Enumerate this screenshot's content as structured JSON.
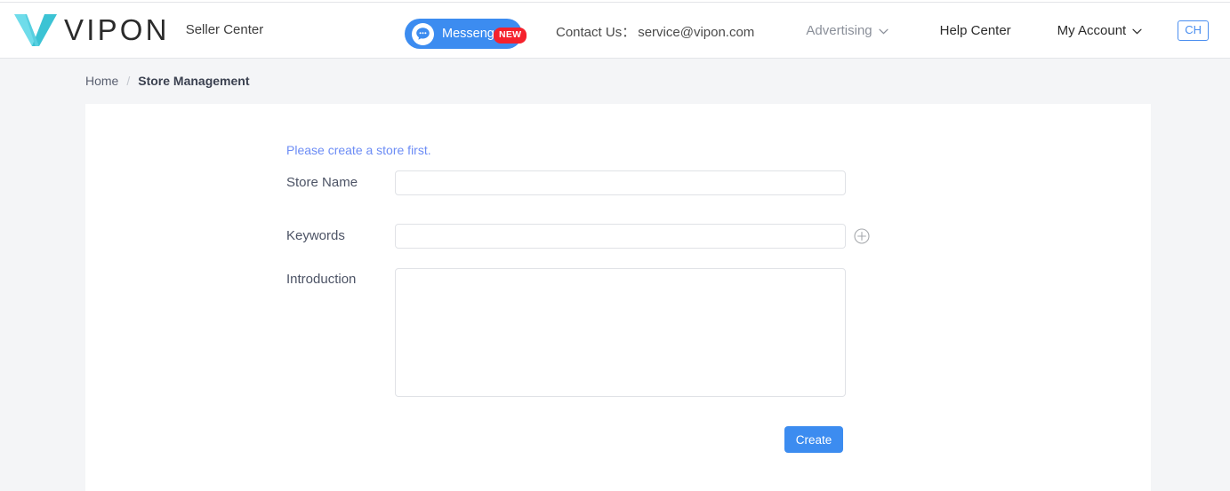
{
  "theme": {
    "page_bg": "#f4f5f7",
    "card_bg": "#ffffff",
    "accent_blue": "#3c8cf0",
    "badge_red": "#f5222d",
    "notice_blue": "#6c8cf5",
    "logo_cyan_light": "#6fdcea",
    "logo_cyan_dark": "#3cc3d4",
    "border_gray": "#e0e2e6"
  },
  "header": {
    "logo": {
      "icon": "vipon-v-logo-icon",
      "wordmark": "VIPON"
    },
    "seller_center": "Seller Center",
    "messenger": {
      "icon": "chat-bubble-icon",
      "label": "Messenger",
      "badge": "NEW"
    },
    "contact": {
      "label": "Contact Us：",
      "email": "service@vipon.com"
    },
    "nav": [
      {
        "label": "Advertising",
        "has_caret": true,
        "muted": true
      },
      {
        "label": "Help Center",
        "has_caret": false,
        "muted": false
      },
      {
        "label": "My Account",
        "has_caret": true,
        "muted": false
      }
    ],
    "language_button": "CH"
  },
  "breadcrumb": {
    "home": "Home",
    "separator": "/",
    "current": "Store Management"
  },
  "form": {
    "notice": "Please create a store first.",
    "fields": {
      "store_name": {
        "label": "Store Name",
        "value": "",
        "placeholder": ""
      },
      "keywords": {
        "label": "Keywords",
        "value": "",
        "placeholder": "",
        "add_icon": "plus-circle-icon"
      },
      "introduction": {
        "label": "Introduction",
        "value": "",
        "placeholder": ""
      }
    },
    "submit_label": "Create"
  }
}
